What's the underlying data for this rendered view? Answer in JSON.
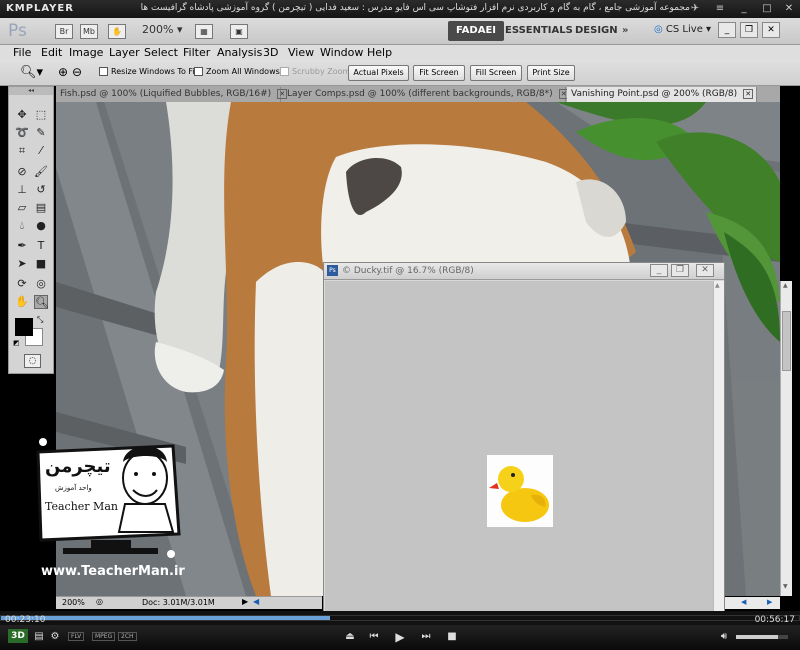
{
  "player": {
    "brand": "KMPLAYER",
    "caption": "مجموعه آموزشی جامع ، گام به گام و کاربردی نرم افزار فتوشاپ سی اس فایو  مدرس : سعید فدایی ( تیچرمن ) گروه آموزشی پادشاه گرافیست ها",
    "elapsed": "00:23:10",
    "total": "00:56:17",
    "progress": 0.412,
    "volume": 0.8,
    "format_badges": [
      "FLV",
      "MPEG",
      "2CH"
    ],
    "mode_badge": "3D"
  },
  "ps": {
    "app_logo": "Ps",
    "app_buttons": [
      "Br",
      "Mb"
    ],
    "zoom_level": "200%",
    "workspaces": [
      "FADAEI",
      "ESSENTIALS",
      "DESIGN"
    ],
    "more": "»",
    "cs_live": "CS Live",
    "menu": [
      "File",
      "Edit",
      "Image",
      "Layer",
      "Select",
      "Filter",
      "Analysis",
      "3D",
      "View",
      "Window",
      "Help"
    ],
    "options": {
      "resize_windows": "Resize Windows To Fit",
      "zoom_all": "Zoom All Windows",
      "scrubby_zoom": "Scrubby Zoom",
      "actual_pixels": "Actual Pixels",
      "fit_screen": "Fit Screen",
      "fill_screen": "Fill Screen",
      "print_size": "Print Size"
    },
    "tabs": [
      {
        "label": "Fish.psd @ 100% (Liquified Bubbles, RGB/16#)"
      },
      {
        "label": "Layer Comps.psd @ 100% (different backgrounds, RGB/8*)"
      },
      {
        "label": "Vanishing Point.psd @ 200% (RGB/8)"
      }
    ],
    "ducky_window_title": "© Ducky.tif @ 16.7% (RGB/8)",
    "status_zoom": "200%",
    "status_doc": "Doc: 3.01M/3.01M"
  },
  "watermark": {
    "persian_name": "تیچرمن",
    "tagline": "واحد آموزش",
    "name": "Teacher Man",
    "url": "www.TeacherMan.ir"
  },
  "colors": {
    "fg_swatch": "#000000",
    "bg_swatch": "#ffffff",
    "leaf": "#3d7a2b",
    "dog_tan": "#b97a3e"
  }
}
